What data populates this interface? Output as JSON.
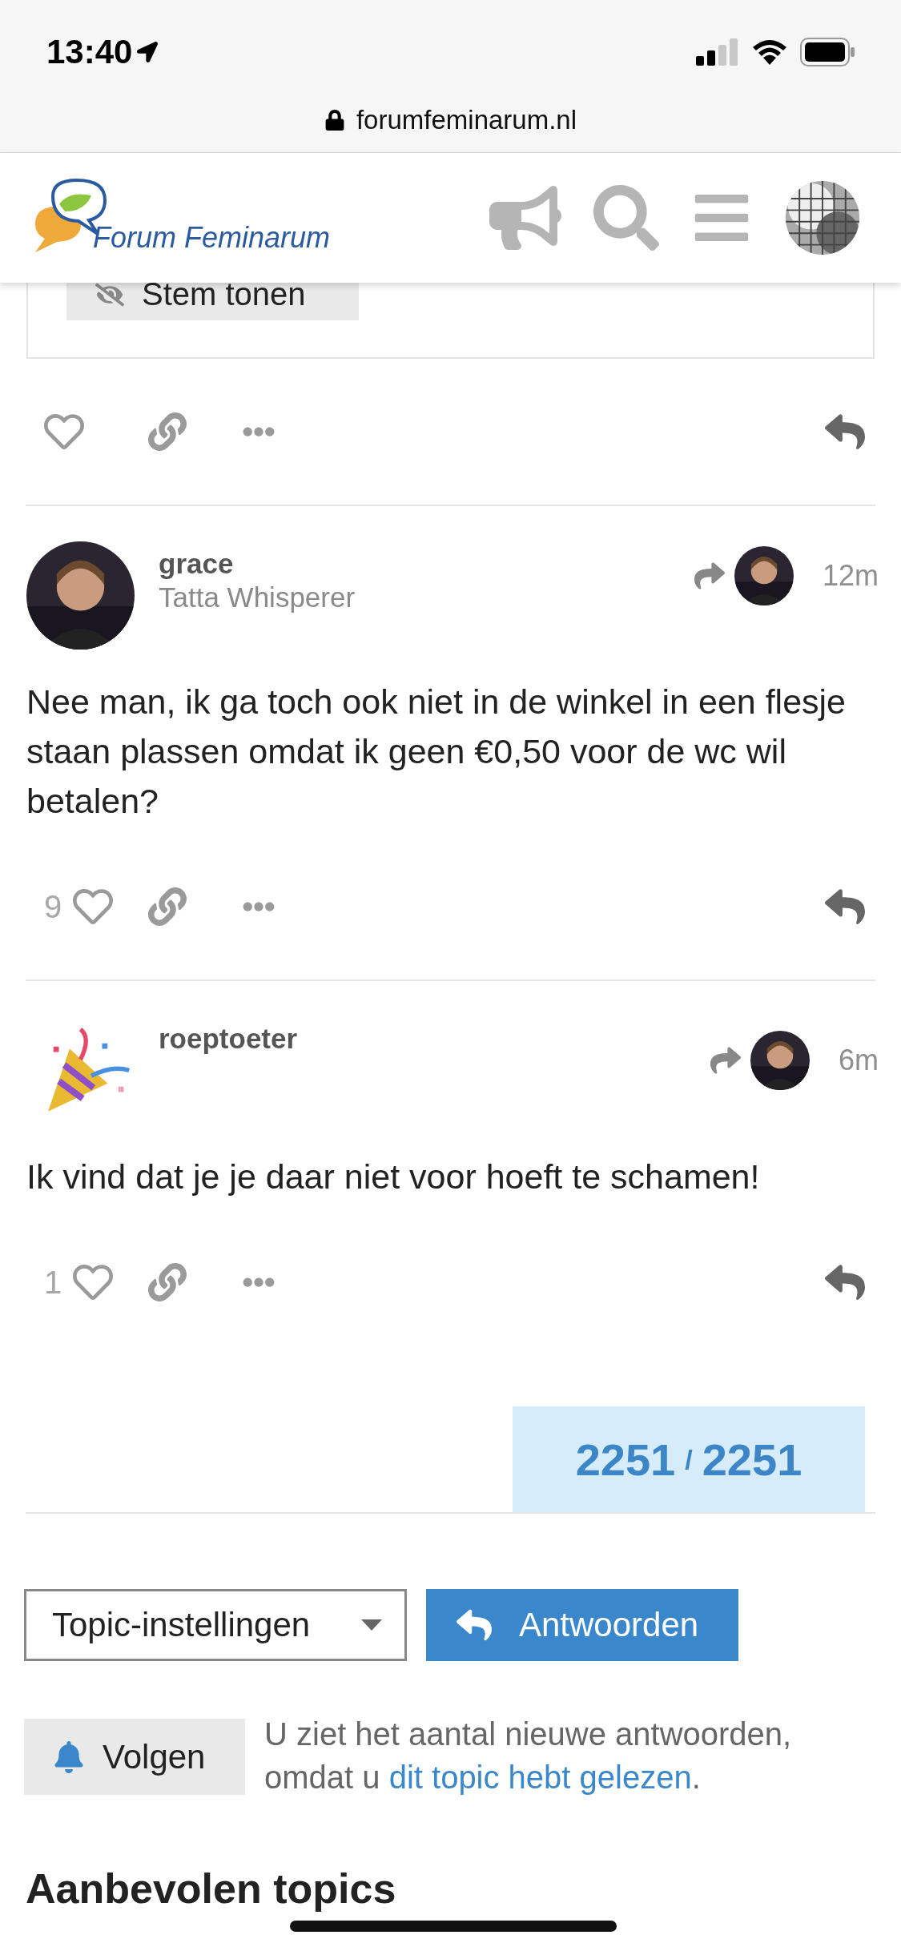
{
  "status_bar": {
    "time": "13:40"
  },
  "browser": {
    "url": "forumfeminarum.nl"
  },
  "header": {
    "site_name": "Forum Feminarum"
  },
  "poll": {
    "show_votes_button": "Stem tonen"
  },
  "posts": [
    {
      "username": "grace",
      "user_title": "Tatta Whisperer",
      "time": "12m",
      "body": "Nee man, ik ga toch ook niet in de winkel in een flesje staan plassen omdat ik geen €0,50 voor de wc wil betalen?",
      "likes": "9"
    },
    {
      "username": "roeptoeter",
      "time": "6m",
      "avatar": {
        "kind": "emoji"
      },
      "body": "Ik vind dat je je daar niet voor hoeft te schamen!",
      "likes": "1"
    }
  ],
  "progress": {
    "current": "2251",
    "separator": "/",
    "total": "2251"
  },
  "controls": {
    "topic_settings": "Topic-instellingen",
    "reply_button": "Antwoorden"
  },
  "notification": {
    "button": "Volgen",
    "text_before": "U ziet het aantal nieuwe antwoorden, omdat u ",
    "link": "dit topic hebt gelezen",
    "text_after": "."
  },
  "related": {
    "heading": "Aanbevolen topics"
  }
}
